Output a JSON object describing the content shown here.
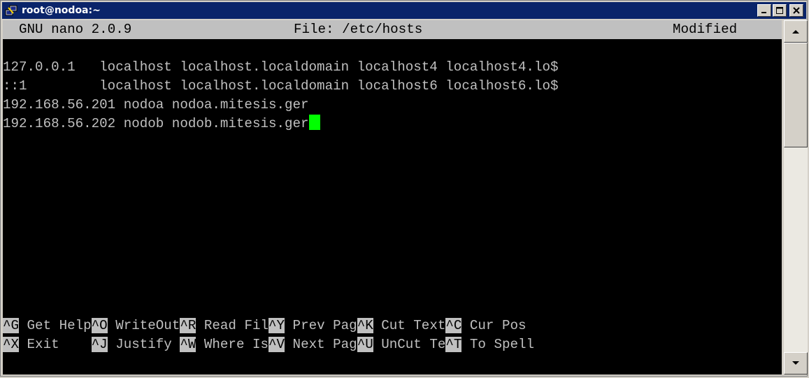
{
  "window": {
    "title": "root@nodoa:~",
    "icon": "putty-icon"
  },
  "nano": {
    "header": {
      "app": "GNU nano 2.0.9",
      "file": "File: /etc/hosts",
      "status": "Modified"
    },
    "lines": [
      "",
      "127.0.0.1   localhost localhost.localdomain localhost4 localhost4.lo$",
      "::1         localhost localhost.localdomain localhost6 localhost6.lo$",
      "192.168.56.201 nodoa nodoa.mitesis.ger",
      "192.168.56.202 nodob nodob.mitesis.ger"
    ],
    "shortcuts_row1": [
      {
        "key": "^G",
        "label": " Get Help"
      },
      {
        "key": "^O",
        "label": " WriteOut"
      },
      {
        "key": "^R",
        "label": " Read Fil"
      },
      {
        "key": "^Y",
        "label": " Prev Pag"
      },
      {
        "key": "^K",
        "label": " Cut Text"
      },
      {
        "key": "^C",
        "label": " Cur Pos"
      }
    ],
    "shortcuts_row2": [
      {
        "key": "^X",
        "label": " Exit    "
      },
      {
        "key": "^J",
        "label": " Justify "
      },
      {
        "key": "^W",
        "label": " Where Is"
      },
      {
        "key": "^V",
        "label": " Next Pag"
      },
      {
        "key": "^U",
        "label": " UnCut Te"
      },
      {
        "key": "^T",
        "label": " To Spell"
      }
    ]
  },
  "colors": {
    "terminal_bg": "#000000",
    "terminal_fg": "#c0c0c0",
    "cursor": "#00ff00",
    "titlebar": "#0a246a"
  }
}
